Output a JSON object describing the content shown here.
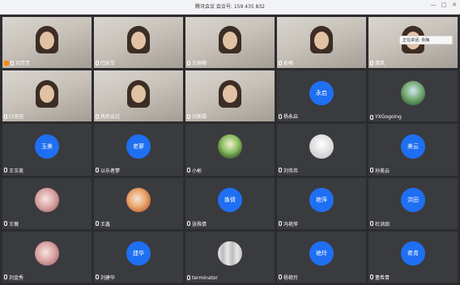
{
  "window": {
    "title": "腾讯会议 会议号: 159 435 832",
    "controls": [
      "—",
      "□",
      "✕"
    ]
  },
  "overlay": {
    "text": "正在讲话: 俞梅"
  },
  "participants": [
    {
      "name": "刘芳芳",
      "type": "video",
      "host": true
    },
    {
      "name": "闫友军",
      "type": "video"
    },
    {
      "name": "王丽梅",
      "type": "video"
    },
    {
      "name": "俞梅",
      "type": "video"
    },
    {
      "name": "清风",
      "type": "video"
    },
    {
      "name": "LY花花",
      "type": "video"
    },
    {
      "name": "风吹云过",
      "type": "video"
    },
    {
      "name": "刘美霞",
      "type": "video"
    },
    {
      "name": "杨永启",
      "type": "avatar",
      "initials": "永启"
    },
    {
      "name": "YXGogoing",
      "type": "image",
      "image": "tree"
    },
    {
      "name": "王玉美",
      "type": "avatar",
      "initials": "玉美"
    },
    {
      "name": "以乐者蓼",
      "type": "avatar",
      "initials": "老蓼"
    },
    {
      "name": "小彬",
      "type": "image",
      "image": "game"
    },
    {
      "name": "刘伟伟",
      "type": "image",
      "image": "gray"
    },
    {
      "name": "孙美云",
      "type": "avatar",
      "initials": "美云"
    },
    {
      "name": "王薇",
      "type": "image",
      "image": "pink"
    },
    {
      "name": "王鑫",
      "type": "image",
      "image": "flowers"
    },
    {
      "name": "张殊倩",
      "type": "avatar",
      "initials": "姝倩"
    },
    {
      "name": "冯艳萍",
      "type": "avatar",
      "initials": "艳萍"
    },
    {
      "name": "杜洪田",
      "type": "avatar",
      "initials": "洪田"
    },
    {
      "name": "刘金秀",
      "type": "image",
      "image": "pink"
    },
    {
      "name": "刘建华",
      "type": "avatar",
      "initials": "建华"
    },
    {
      "name": "terminator",
      "type": "image",
      "image": "window"
    },
    {
      "name": "杨艳玲",
      "type": "avatar",
      "initials": "艳玲"
    },
    {
      "name": "董希青",
      "type": "avatar",
      "initials": "希青"
    }
  ]
}
